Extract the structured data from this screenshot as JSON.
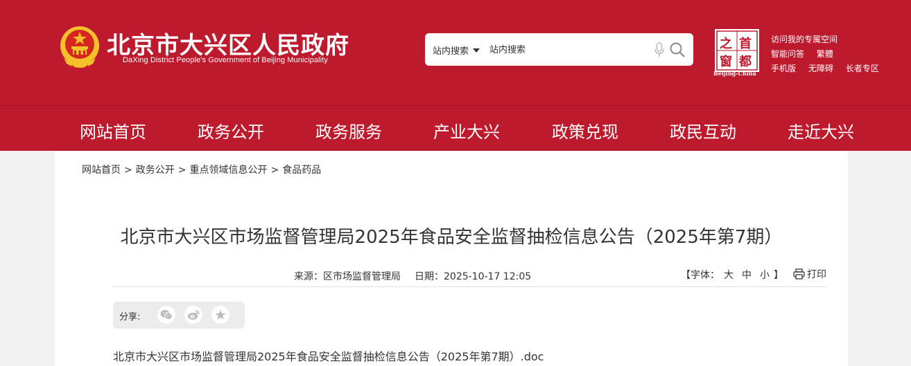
{
  "header": {
    "site_title": "北京市大兴区人民政府",
    "site_subtitle": "DaXing District People's Government of Beijing Municipality",
    "search": {
      "scope_label": "站内搜索",
      "placeholder": "站内搜索"
    },
    "capital_logo": {
      "chars": [
        "首",
        "都",
        "之",
        "窗"
      ],
      "caption": "Beijing-China"
    },
    "quick_links": {
      "row1": [
        "访问我的专属空间"
      ],
      "row2": [
        "智能问答",
        "繁體"
      ],
      "row3": [
        "手机版",
        "无障碍",
        "长者专区"
      ]
    }
  },
  "nav": {
    "items": [
      "网站首页",
      "政务公开",
      "政务服务",
      "产业大兴",
      "政策兑现",
      "政民互动",
      "走近大兴"
    ]
  },
  "breadcrumb": {
    "items": [
      "网站首页",
      "政务公开",
      "重点领域信息公开",
      "食品药品"
    ],
    "separator": ">"
  },
  "article": {
    "title": "北京市大兴区市场监督管理局2025年食品安全监督抽检信息公告（2025年第7期）",
    "source": "来源：区市场监督管理局",
    "date": "日期：2025-10-17 12:05",
    "font_label_open": "【字体：",
    "font_options": [
      "大",
      "中",
      "小"
    ],
    "font_label_close": "】",
    "print_label": "打印",
    "share_label": "分享:",
    "share_icons": [
      "wechat-icon",
      "weibo-icon",
      "favorite-star-icon"
    ],
    "attachment": "北京市大兴区市场监督管理局2025年食品安全监督抽检信息公告（2025年第7期）.doc"
  },
  "colors": {
    "brand_red": "#bd1a2d",
    "gold": "#f4c12b",
    "page_bg": "#f2f2f2"
  }
}
